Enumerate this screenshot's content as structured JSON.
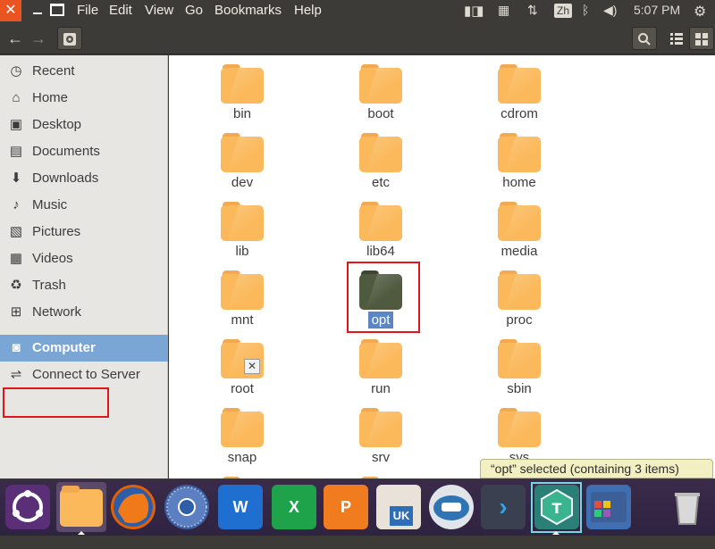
{
  "menubar": {
    "menus": [
      "File",
      "Edit",
      "View",
      "Go",
      "Bookmarks",
      "Help"
    ],
    "input_method": "Zh",
    "clock": "5:07 PM"
  },
  "sidebar": {
    "items": [
      {
        "label": "Recent",
        "icon": "clock-icon"
      },
      {
        "label": "Home",
        "icon": "home-icon"
      },
      {
        "label": "Desktop",
        "icon": "desktop-icon"
      },
      {
        "label": "Documents",
        "icon": "document-icon"
      },
      {
        "label": "Downloads",
        "icon": "download-icon"
      },
      {
        "label": "Music",
        "icon": "music-icon"
      },
      {
        "label": "Pictures",
        "icon": "picture-icon"
      },
      {
        "label": "Videos",
        "icon": "video-icon"
      },
      {
        "label": "Trash",
        "icon": "trash-icon"
      },
      {
        "label": "Network",
        "icon": "network-icon"
      },
      {
        "label": "Computer",
        "icon": "computer-icon",
        "active": true
      },
      {
        "label": "Connect to Server",
        "icon": "server-icon"
      }
    ]
  },
  "files": [
    {
      "name": "bin"
    },
    {
      "name": "boot"
    },
    {
      "name": "cdrom"
    },
    {
      "name": "dev"
    },
    {
      "name": "etc"
    },
    {
      "name": "home"
    },
    {
      "name": "lib"
    },
    {
      "name": "lib64"
    },
    {
      "name": "media"
    },
    {
      "name": "mnt"
    },
    {
      "name": "opt",
      "selected": true
    },
    {
      "name": "proc"
    },
    {
      "name": "root",
      "emblem": "locked"
    },
    {
      "name": "run"
    },
    {
      "name": "sbin"
    },
    {
      "name": "snap"
    },
    {
      "name": "srv"
    },
    {
      "name": "sys"
    }
  ],
  "status": "“opt” selected  (containing 3 items)",
  "dock": [
    {
      "name": "ubuntu-launcher-icon",
      "color": "#6c3f87"
    },
    {
      "name": "files-app-icon",
      "color": "#f6a94a"
    },
    {
      "name": "firefox-icon",
      "color": "#e66000"
    },
    {
      "name": "chromium-icon",
      "color": "#3d6fb6"
    },
    {
      "name": "wps-writer-icon",
      "color": "#1e88e5",
      "text": "W"
    },
    {
      "name": "wps-spreadsheet-icon",
      "color": "#1fa34a",
      "text": "X"
    },
    {
      "name": "wps-presentation-icon",
      "color": "#f07c1f",
      "text": "P"
    },
    {
      "name": "software-center-icon",
      "color": "#e8e2d8",
      "text": "UK"
    },
    {
      "name": "remmina-icon",
      "color": "#2f75b5"
    },
    {
      "name": "vscode-icon",
      "color": "#3a4050",
      "text": "›"
    },
    {
      "name": "typora-icon",
      "color": "#39b48f"
    },
    {
      "name": "window-manager-icon",
      "color": "#3f6fb0"
    },
    {
      "name": "trash-dock-icon",
      "color": "#8e8e8e"
    }
  ]
}
